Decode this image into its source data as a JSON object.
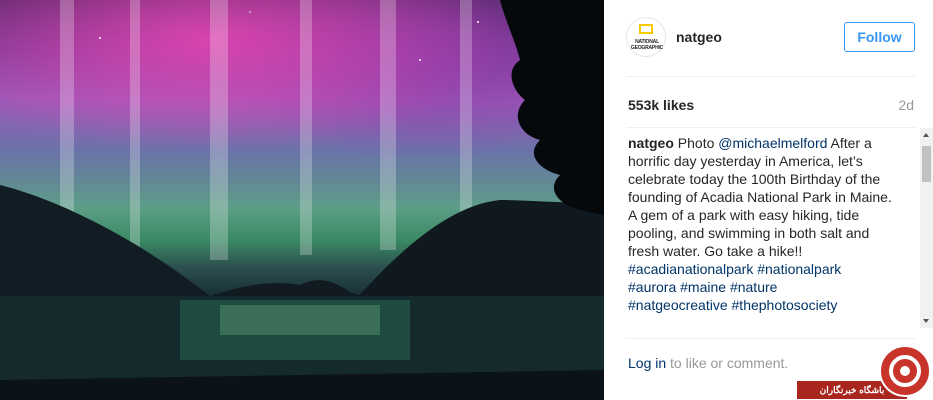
{
  "post": {
    "username": "natgeo",
    "follow_label": "Follow",
    "avatar_text": "NATIONAL GEOGRAPHIC",
    "likes": "553k likes",
    "age": "2d",
    "caption": {
      "user": "natgeo",
      "text1": "Photo",
      "mention": "@michaelmelford",
      "text2": "After a horrific day yesterday in America, let’s celebrate today the 100th Birthday of the founding of Acadia National Park in Maine.",
      "text3": "A gem of a park with easy hiking, tide pooling, and swimming in both salt and fresh water. Go take a hike!!",
      "hashtags_line1": "#acadianationalpark #nationalpark",
      "hashtags_line2": "#aurora #maine #nature",
      "hashtags_line3": "#natgeocreative #thephotosociety"
    },
    "comment": {
      "login_label": "Log in",
      "rest": "to like or comment."
    }
  },
  "watermark": {
    "text": "باشگاه خبرنگاران"
  }
}
